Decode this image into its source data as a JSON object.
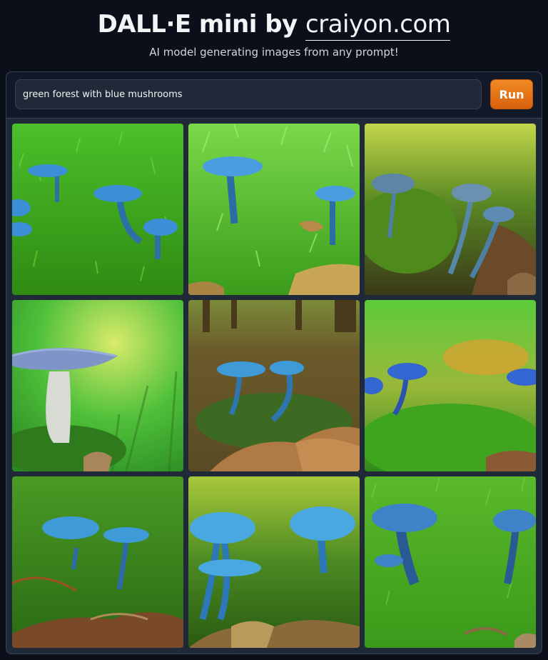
{
  "header": {
    "title_prefix": "DALL·E mini by",
    "title_link": "craiyon.com",
    "subtitle": "AI model generating images from any prompt!"
  },
  "prompt": {
    "value": "green forest with blue mushrooms",
    "run_label": "Run"
  },
  "colors": {
    "background": "#0b0f19",
    "panel": "#1f2937",
    "run_button": "#ea7b1c",
    "mushroom_blue": "#3b8fd6",
    "moss_green": "#3fae1e"
  },
  "gallery": {
    "images": [
      {
        "icon": "generated-image-1"
      },
      {
        "icon": "generated-image-2"
      },
      {
        "icon": "generated-image-3"
      },
      {
        "icon": "generated-image-4"
      },
      {
        "icon": "generated-image-5"
      },
      {
        "icon": "generated-image-6"
      },
      {
        "icon": "generated-image-7"
      },
      {
        "icon": "generated-image-8"
      },
      {
        "icon": "generated-image-9"
      }
    ]
  }
}
